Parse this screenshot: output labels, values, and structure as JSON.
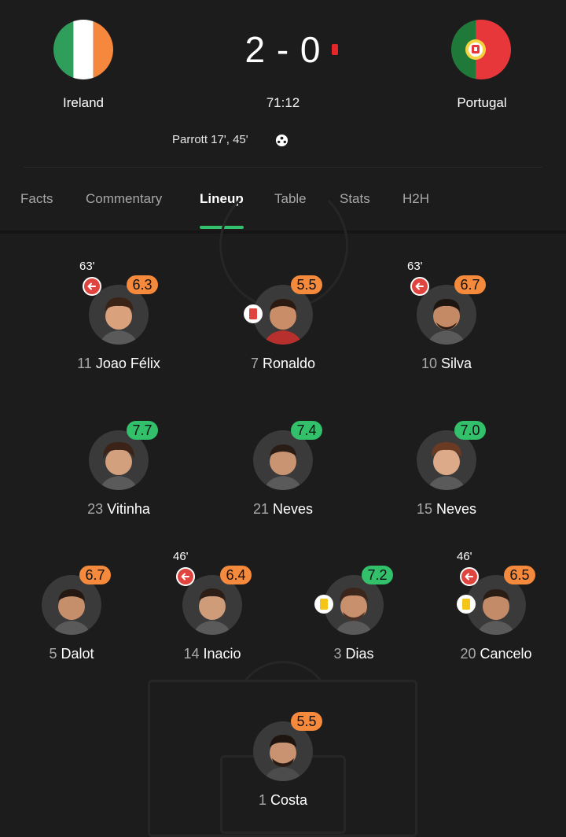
{
  "match": {
    "home_team": "Ireland",
    "away_team": "Portugal",
    "score": "2 - 0",
    "clock": "71:12",
    "scorer": "Parrott 17', 45'"
  },
  "tabs": [
    {
      "label": "Facts",
      "active": false
    },
    {
      "label": "Commentary",
      "active": false
    },
    {
      "label": "Lineup",
      "active": true
    },
    {
      "label": "Table",
      "active": false
    },
    {
      "label": "Stats",
      "active": false
    },
    {
      "label": "H2H",
      "active": false
    }
  ],
  "lineup": {
    "forwards": [
      {
        "number": "11",
        "name": "Joao Félix",
        "rating": "6.3",
        "rating_color": "orange",
        "sub_minute": "63'",
        "subbed_off": true,
        "card": null
      },
      {
        "number": "7",
        "name": "Ronaldo",
        "rating": "5.5",
        "rating_color": "orange",
        "sub_minute": null,
        "subbed_off": false,
        "card": "red"
      },
      {
        "number": "10",
        "name": "Silva",
        "rating": "6.7",
        "rating_color": "orange",
        "sub_minute": "63'",
        "subbed_off": true,
        "card": null
      }
    ],
    "midfielders": [
      {
        "number": "23",
        "name": "Vitinha",
        "rating": "7.7",
        "rating_color": "green"
      },
      {
        "number": "21",
        "name": "Neves",
        "rating": "7.4",
        "rating_color": "green"
      },
      {
        "number": "15",
        "name": "Neves",
        "rating": "7.0",
        "rating_color": "green"
      }
    ],
    "defenders": [
      {
        "number": "5",
        "name": "Dalot",
        "rating": "6.7",
        "rating_color": "orange",
        "sub_minute": null,
        "card": null
      },
      {
        "number": "14",
        "name": "Inacio",
        "rating": "6.4",
        "rating_color": "orange",
        "sub_minute": "46'",
        "subbed_off": true,
        "card": null
      },
      {
        "number": "3",
        "name": "Dias",
        "rating": "7.2",
        "rating_color": "green",
        "sub_minute": null,
        "card": "yellow"
      },
      {
        "number": "20",
        "name": "Cancelo",
        "rating": "6.5",
        "rating_color": "orange",
        "sub_minute": "46'",
        "subbed_off": true,
        "card": "yellow"
      }
    ],
    "goalkeeper": {
      "number": "1",
      "name": "Costa",
      "rating": "5.5",
      "rating_color": "orange"
    }
  },
  "colors": {
    "background": "#1c1c1c",
    "rating_orange": "#f58a3c",
    "rating_green": "#32c06b",
    "tab_indicator": "#32c06b",
    "red_card": "#e0443e",
    "yellow_card": "#f5c518",
    "live_indicator": "#e5262b"
  },
  "icons": {
    "home_flag": "ireland-flag-icon",
    "away_flag": "portugal-flag-icon",
    "goal": "football-icon",
    "substitution": "sub-off-arrow-icon",
    "red_card": "red-card-icon",
    "yellow_card": "yellow-card-icon"
  }
}
